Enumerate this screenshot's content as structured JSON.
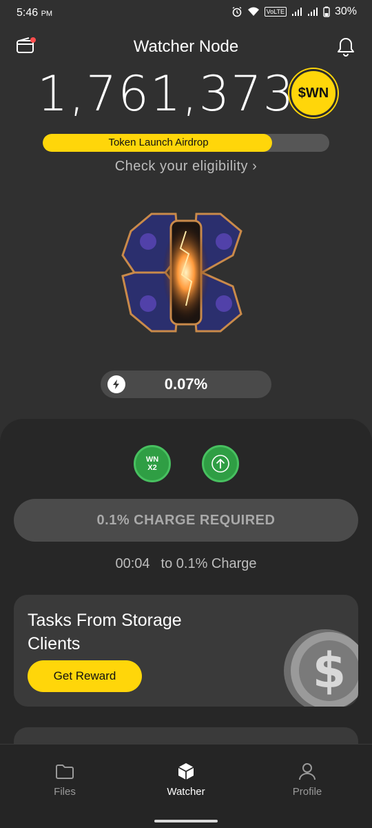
{
  "status_bar": {
    "time": "5:46",
    "time_suffix": "PM",
    "network_label": "VoLTE",
    "battery": "30%"
  },
  "header": {
    "title": "Watcher Node",
    "wallet_icon": "wallet-icon",
    "bell_icon": "bell-icon"
  },
  "balance": {
    "value": "1,761,373",
    "token_symbol": "$WN"
  },
  "airdrop": {
    "label": "Token Launch Airdrop",
    "progress_fraction": 0.8,
    "eligibility_text": "Check your eligibility",
    "eligibility_chevron": "›"
  },
  "charge": {
    "value": "0.07%",
    "icon": "lightning-icon"
  },
  "boosts": {
    "multiplier_label_top": "WN",
    "multiplier_label_bottom": "X2",
    "upgrade_icon": "arrow-up-icon"
  },
  "charge_required": {
    "label": "0.1% CHARGE REQUIRED",
    "timer": "00:04",
    "timer_suffix": "to 0.1% Charge"
  },
  "tasks_card": {
    "title": "Tasks From Storage Clients",
    "button_label": "Get Reward",
    "art_icon": "dollar-coin-icon"
  },
  "colors": {
    "accent": "#ffd60a",
    "green": "#2f9e44",
    "background": "#303030"
  },
  "nav": {
    "items": [
      {
        "label": "Files",
        "icon": "folder-icon",
        "active": false
      },
      {
        "label": "Watcher",
        "icon": "cube-icon",
        "active": true
      },
      {
        "label": "Profile",
        "icon": "user-icon",
        "active": false
      }
    ]
  }
}
